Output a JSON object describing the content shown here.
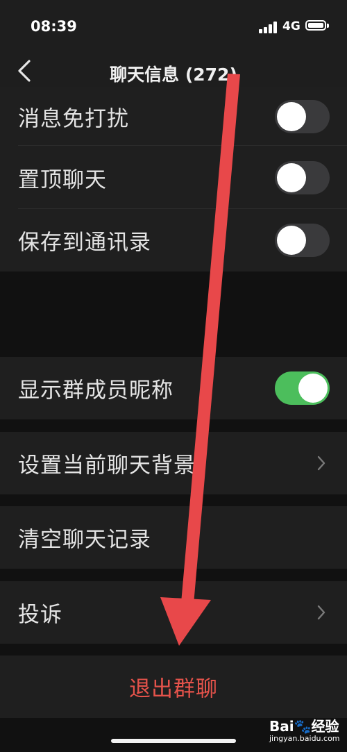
{
  "status_bar": {
    "time": "08:39",
    "network": "4G"
  },
  "nav": {
    "title": "聊天信息 (272)"
  },
  "settings": {
    "mute_label": "消息免打扰",
    "pin_label": "置顶聊天",
    "save_contacts_label": "保存到通讯录",
    "show_nicknames_label": "显示群成员昵称",
    "background_label": "设置当前聊天背景",
    "clear_history_label": "清空聊天记录",
    "complaint_label": "投诉",
    "exit_group_label": "退出群聊"
  },
  "toggles": {
    "mute": false,
    "pin": false,
    "save_contacts": false,
    "show_nicknames": true
  },
  "colors": {
    "background": "#111111",
    "row": "#1f1f1f",
    "toggle_on": "#4cbe5c",
    "toggle_off": "#3a3a3c",
    "danger": "#e5534b",
    "annotation_arrow": "#e8484a"
  },
  "icons": {
    "back": "chevron-left-icon",
    "chevron": "chevron-right-icon"
  },
  "watermark": {
    "logo": "Bai🐾经验",
    "url": "jingyan.baidu.com"
  }
}
